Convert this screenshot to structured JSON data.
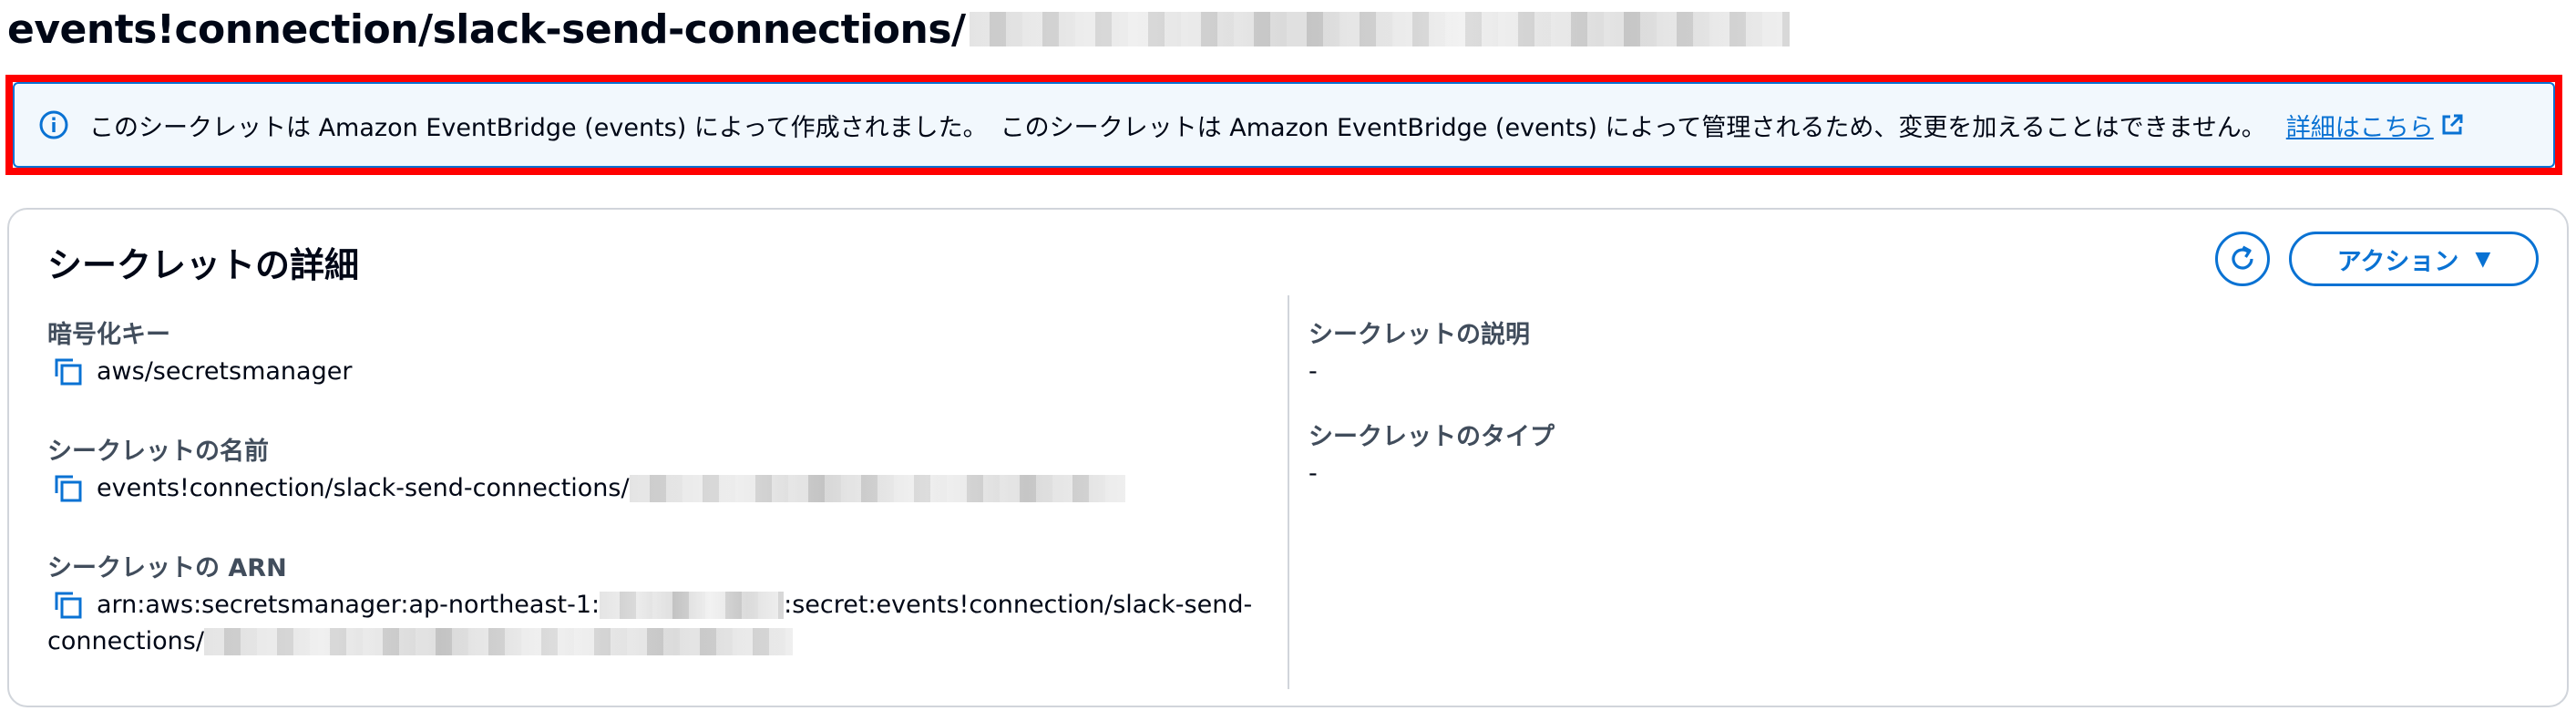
{
  "page": {
    "title": "events!connection/slack-send-connections/"
  },
  "alert": {
    "message1": "このシークレットは Amazon EventBridge (events) によって作成されました。",
    "message2": "このシークレットは Amazon EventBridge (events) によって管理されるため、変更を加えることはできません。",
    "link_label": "詳細はこちら",
    "icon": "info-icon",
    "color": "#0972d3"
  },
  "details": {
    "title": "シークレットの詳細",
    "action_label": "アクション",
    "refresh_icon": "refresh-icon",
    "left": {
      "encryption_key_label": "暗号化キー",
      "encryption_key_value": "aws/secretsmanager",
      "name_label": "シークレットの名前",
      "name_value": "events!connection/slack-send-connections/",
      "arn_label": "シークレットの ARN",
      "arn_prefix": "arn:aws:secretsmanager:ap-northeast-1:",
      "arn_middle": ":secret:events!connection/slack-send-",
      "arn_line2": "connections/"
    },
    "right": {
      "description_label": "シークレットの説明",
      "description_value": "-",
      "type_label": "シークレットのタイプ",
      "type_value": "-"
    }
  }
}
